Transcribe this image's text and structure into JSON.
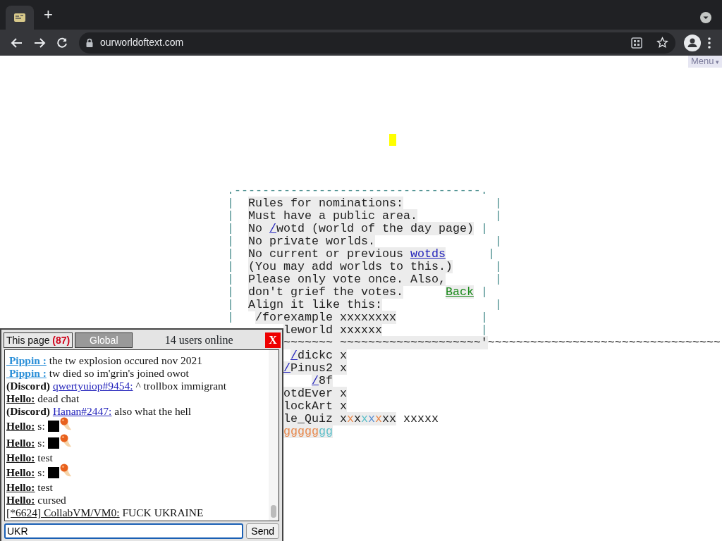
{
  "browser": {
    "url": "ourworldoftext.com",
    "new_tab": "+"
  },
  "menu": {
    "label": "Menu",
    "caret": "▾"
  },
  "world": {
    "lines": [
      {
        "segments": [
          {
            "text": ".-----------------------------------.",
            "kind": "border"
          }
        ]
      },
      {
        "segments": [
          {
            "text": "|",
            "kind": "border"
          },
          {
            "text": "  Rules for nominations:",
            "kind": "plain",
            "shaded": true
          },
          {
            "text": "             |",
            "kind": "border"
          }
        ]
      },
      {
        "segments": [
          {
            "text": "|",
            "kind": "border"
          },
          {
            "text": "  Must have a public area.",
            "kind": "plain",
            "shaded": true
          },
          {
            "text": "           |",
            "kind": "border"
          }
        ]
      },
      {
        "segments": [
          {
            "text": "|",
            "kind": "border"
          },
          {
            "text": "  No ",
            "kind": "plain",
            "shaded": true
          },
          {
            "text": "/",
            "kind": "link",
            "shaded": true
          },
          {
            "text": "wotd (world of the day page)",
            "kind": "plain",
            "shaded": true
          },
          {
            "text": " |",
            "kind": "border"
          }
        ]
      },
      {
        "segments": [
          {
            "text": "|",
            "kind": "border"
          },
          {
            "text": "  No private worlds.",
            "kind": "plain",
            "shaded": true
          },
          {
            "text": "                 |",
            "kind": "border"
          }
        ]
      },
      {
        "segments": [
          {
            "text": "|",
            "kind": "border"
          },
          {
            "text": "  No current or previous ",
            "kind": "plain",
            "shaded": true
          },
          {
            "text": "wotds",
            "kind": "link",
            "shaded": true
          },
          {
            "text": "      |",
            "kind": "border"
          }
        ]
      },
      {
        "segments": [
          {
            "text": "|",
            "kind": "border"
          },
          {
            "text": "  (You may add worlds to this.)",
            "kind": "plain",
            "shaded": true
          },
          {
            "text": "      |",
            "kind": "border"
          }
        ]
      },
      {
        "segments": [
          {
            "text": "|",
            "kind": "border"
          },
          {
            "text": "  Please only vote once. Also,",
            "kind": "plain",
            "shaded": true
          },
          {
            "text": "       |",
            "kind": "border"
          }
        ]
      },
      {
        "segments": [
          {
            "text": "|",
            "kind": "border"
          },
          {
            "text": "  don't grief the votes.",
            "kind": "plain",
            "shaded": true
          },
          {
            "text": "      Back",
            "kind": "back-link",
            "shaded": true
          },
          {
            "text": " |",
            "kind": "border"
          }
        ]
      },
      {
        "segments": [
          {
            "text": "|",
            "kind": "border"
          },
          {
            "text": "  Align it like this:",
            "kind": "plain",
            "shaded": true
          },
          {
            "text": "                |",
            "kind": "border"
          }
        ]
      },
      {
        "segments": [
          {
            "text": "|",
            "kind": "border"
          },
          {
            "text": "   /forexample xxxxxxxx",
            "kind": "plain",
            "shaded": true
          },
          {
            "text": "            |",
            "kind": "border"
          }
        ]
      },
      {
        "segments": [
          {
            "text": "        leworld xxxxxx",
            "kind": "plain",
            "shaded": true
          },
          {
            "text": "              |",
            "kind": "border"
          }
        ]
      },
      {
        "segments": [
          {
            "text": "        ~~~~~~~ ~~~~~~~~~~~~~~~~~~~~'",
            "kind": "plain",
            "shaded": true
          },
          {
            "text": "~~~~~~~~~~~~~~~~~~~~~~~~~~~~~~~~~",
            "kind": "plain",
            "shaded": false
          }
        ]
      },
      {
        "segments": [
          {
            "text": "         /",
            "kind": "link",
            "shaded": true
          },
          {
            "text": "dickc x",
            "kind": "plain",
            "shaded": true
          }
        ]
      },
      {
        "segments": [
          {
            "text": "        /",
            "kind": "link",
            "shaded": true
          },
          {
            "text": "Pinus2 x",
            "kind": "plain",
            "shaded": true
          }
        ]
      },
      {
        "segments": [
          {
            "text": "            /",
            "kind": "link",
            "shaded": true
          },
          {
            "text": "8f",
            "kind": "plain",
            "shaded": true
          }
        ]
      },
      {
        "segments": [
          {
            "text": "        otdEver x",
            "kind": "plain",
            "shaded": true
          }
        ]
      },
      {
        "segments": [
          {
            "text": "        lockArt x",
            "kind": "plain",
            "shaded": true
          }
        ]
      },
      {
        "segments": [
          {
            "text": "        le_Quiz x",
            "kind": "plain",
            "shaded": true
          },
          {
            "text": "x",
            "kind": "colored",
            "shaded": true,
            "color": "#e8874a"
          },
          {
            "text": "x",
            "kind": "plain",
            "shaded": true
          },
          {
            "text": "x",
            "kind": "colored",
            "shaded": true,
            "color": "#5bbfc9"
          },
          {
            "text": "x",
            "kind": "colored",
            "shaded": true,
            "color": "#5a8fd0"
          },
          {
            "text": "x",
            "kind": "colored",
            "shaded": true,
            "color": "#e8874a"
          },
          {
            "text": "xx",
            "kind": "plain",
            "shaded": true
          },
          {
            "text": " xxxxx",
            "kind": "plain",
            "shaded": false
          }
        ]
      },
      {
        "segments": [
          {
            "text": "        ggggg",
            "kind": "colored",
            "shaded": true,
            "color": "#e8874a"
          },
          {
            "text": "gg",
            "kind": "colored",
            "shaded": true,
            "color": "#5bbfc9"
          }
        ]
      }
    ]
  },
  "chat": {
    "tabs": [
      {
        "label": "This page",
        "count": "(87)",
        "selected": true
      },
      {
        "label": "Global",
        "selected": false
      }
    ],
    "users_online": "14 users online",
    "close": "X",
    "messages": [
      {
        "kind": "member",
        "name": " Pippin :",
        "text": "the tw explosion occured nov 2021"
      },
      {
        "kind": "member",
        "name": " Pippin :",
        "text": "tw died so im'grin's joined owot"
      },
      {
        "kind": "discord",
        "prefix": "(Discord)",
        "name": "qwertyuiop#9454:",
        "text": "^ trollbox immigrant"
      },
      {
        "kind": "anon",
        "name": "Hello:",
        "text": "dead chat"
      },
      {
        "kind": "discord",
        "prefix": "(Discord)",
        "name": "Hanan#2447:",
        "text": "also what the hell"
      },
      {
        "kind": "anon",
        "name": "Hello:",
        "text": "s:",
        "emotes": true
      },
      {
        "kind": "anon",
        "name": "Hello:",
        "text": "s:",
        "emotes": true
      },
      {
        "kind": "anon",
        "name": "Hello:",
        "text": "test"
      },
      {
        "kind": "anon",
        "name": "Hello:",
        "text": "s:",
        "emotes": true
      },
      {
        "kind": "anon",
        "name": "Hello:",
        "text": "test"
      },
      {
        "kind": "anon",
        "name": "Hello:",
        "text": "cursed"
      },
      {
        "kind": "bridge",
        "name": "[*6624] CollabVM/VM0:",
        "text": "FUCK UKRAINE"
      }
    ],
    "input": {
      "value": "UKR"
    },
    "send": "Send"
  }
}
